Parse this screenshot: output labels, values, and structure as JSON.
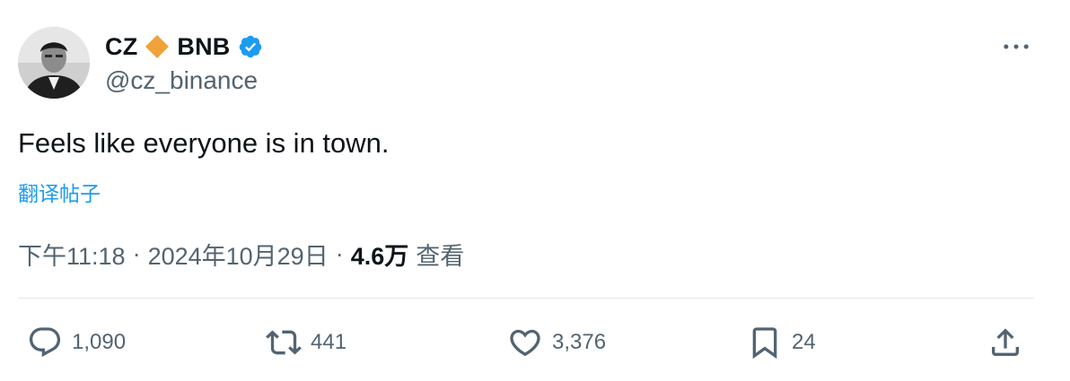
{
  "author": {
    "display_name_part1": "CZ",
    "display_name_part2": "BNB",
    "handle": "@cz_binance",
    "avatar_icon": "profile-photo",
    "verified": true,
    "verified_color": "#1d9bf0",
    "diamond_color": "#f0a23a"
  },
  "post": {
    "text": "Feels like everyone is in town.",
    "translate_label": "翻译帖子",
    "time": "下午11:18",
    "date": "2024年10月29日",
    "separator": "·",
    "views_count": "4.6万",
    "views_label": "查看"
  },
  "actions": {
    "reply": {
      "icon": "reply-icon",
      "count": "1,090"
    },
    "repost": {
      "icon": "repost-icon",
      "count": "441"
    },
    "like": {
      "icon": "heart-icon",
      "count": "3,376"
    },
    "bookmark": {
      "icon": "bookmark-icon",
      "count": "24"
    },
    "share": {
      "icon": "share-icon"
    }
  },
  "colors": {
    "text": "#0f1419",
    "secondary": "#536471",
    "link": "#1d9bf0",
    "divider": "#e1e8ed"
  }
}
